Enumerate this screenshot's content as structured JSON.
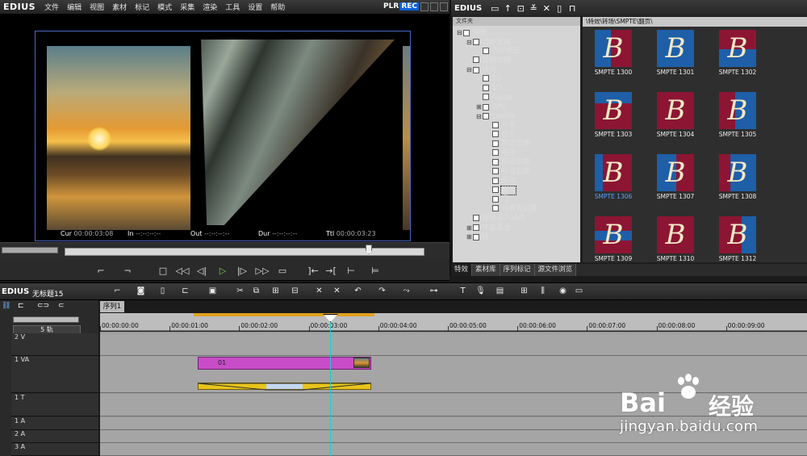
{
  "app": {
    "logo": "EDIUS"
  },
  "menu": [
    "文件",
    "编辑",
    "视图",
    "素材",
    "标记",
    "模式",
    "采集",
    "渲染",
    "工具",
    "设置",
    "帮助"
  ],
  "player": {
    "mode_plr": "PLR",
    "mode_rec": "REC",
    "cur_label": "Cur",
    "cur_value": "00:00:03:08",
    "in_label": "In",
    "in_value": "--:--:--:--",
    "out_label": "Out",
    "out_value": "--:--:--:--",
    "dur_label": "Dur",
    "dur_value": "--:--:--:--",
    "ttl_label": "Ttl",
    "ttl_value": "00:00:03:23"
  },
  "effects_panel": {
    "logo": "EDIUS",
    "tree_header": "文件夹",
    "path": "\\特效\\转场\\SMPTE\\翻页\\",
    "tree": [
      {
        "label": "特效",
        "level": 0,
        "exp": "⊟"
      },
      {
        "label": "视频滤镜",
        "level": 1,
        "exp": "⊟"
      },
      {
        "label": "色彩校正",
        "level": 2,
        "exp": ""
      },
      {
        "label": "音频滤镜",
        "level": 1,
        "exp": ""
      },
      {
        "label": "转场",
        "level": 1,
        "exp": "⊟"
      },
      {
        "label": "2D",
        "level": 2,
        "exp": ""
      },
      {
        "label": "3D",
        "level": 2,
        "exp": ""
      },
      {
        "label": "Alpha",
        "level": 2,
        "exp": ""
      },
      {
        "label": "GPU",
        "level": 2,
        "exp": "⊞"
      },
      {
        "label": "SMPTE",
        "level": 2,
        "exp": "⊟"
      },
      {
        "label": "分离",
        "level": 3,
        "exp": ""
      },
      {
        "label": "卷页",
        "level": 3,
        "exp": ""
      },
      {
        "label": "带边划像",
        "level": 3,
        "exp": ""
      },
      {
        "label": "推挤",
        "level": 3,
        "exp": ""
      },
      {
        "label": "旋转划像",
        "level": 3,
        "exp": ""
      },
      {
        "label": "标准划像",
        "level": 3,
        "exp": ""
      },
      {
        "label": "滑动",
        "level": 3,
        "exp": ""
      },
      {
        "label": "翻页",
        "level": 3,
        "exp": "",
        "selected": true
      },
      {
        "label": "门",
        "level": 3,
        "exp": ""
      },
      {
        "label": "马赛克划像",
        "level": 3,
        "exp": ""
      },
      {
        "label": "音频淡入淡出",
        "level": 1,
        "exp": ""
      },
      {
        "label": "字幕混合",
        "level": 1,
        "exp": "⊞"
      },
      {
        "label": "键",
        "level": 1,
        "exp": "⊞"
      }
    ],
    "thumbs": [
      {
        "label": "SMPTE 1300",
        "letter": "B"
      },
      {
        "label": "SMPTE 1301",
        "letter": "B"
      },
      {
        "label": "SMPTE 1302",
        "letter": "B"
      },
      {
        "label": "SMPTE 1303",
        "letter": "B"
      },
      {
        "label": "SMPTE 1304",
        "letter": "B"
      },
      {
        "label": "SMPTE 1305",
        "letter": "B"
      },
      {
        "label": "SMPTE 1306",
        "letter": "B",
        "selected": true
      },
      {
        "label": "SMPTE 1307",
        "letter": "B"
      },
      {
        "label": "SMPTE 1308",
        "letter": "B"
      },
      {
        "label": "SMPTE 1309",
        "letter": "B"
      },
      {
        "label": "SMPTE 1310",
        "letter": "B"
      },
      {
        "label": "SMPTE 1312",
        "letter": "B"
      }
    ],
    "tabs": [
      "特效",
      "素材库",
      "序列标记",
      "源文件浏览"
    ]
  },
  "timeline": {
    "logo": "EDIUS",
    "project": "无标题15",
    "sequence_tab": "序列1",
    "track_count_label": "5 轨",
    "ruler": [
      "00:00:00:00",
      "00:00:01:00",
      "00:00:02:00",
      "00:00:03:00",
      "00:00:04:00",
      "00:00:05:00",
      "00:00:06:00",
      "00:00:07:00",
      "00:00:08:00",
      "00:00:09:00"
    ],
    "tracks": [
      {
        "name": "2 V"
      },
      {
        "name": "1 VA"
      },
      {
        "name": "1 T"
      },
      {
        "name": "1 A"
      },
      {
        "name": "2 A"
      },
      {
        "name": "3 A"
      }
    ],
    "clip_name": "01"
  },
  "watermark": {
    "brand": "Bai",
    "brand_cn": "经验",
    "url": "jingyan.baidu.com"
  }
}
